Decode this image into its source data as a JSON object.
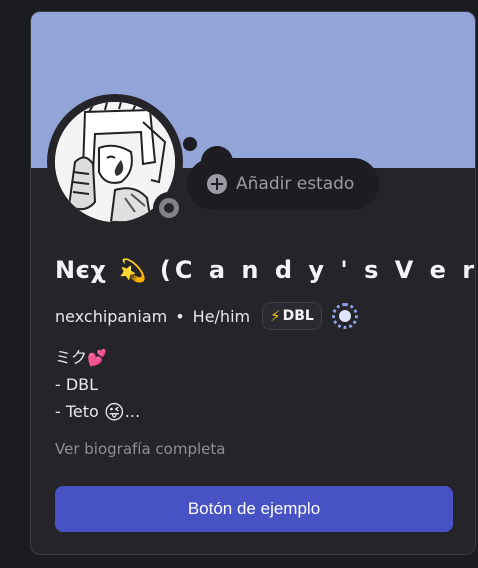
{
  "profile": {
    "display_name_prefix": "Nєχ",
    "display_name_icon": "💫",
    "display_name_suffix": "(C a n d y ' s V e r s)",
    "username": "nexchipaniam",
    "separator": "•",
    "pronouns": "He/him",
    "tag_icon": "⚡",
    "tag_label": "DBL",
    "status_button_label": "Añadir estado",
    "bio_lines": {
      "line1_text": "ミク",
      "line1_emoji": "💕",
      "line2": "- DBL",
      "line3_text": "- Teto",
      "line3_emoji": "😜",
      "line3_tail": "..."
    },
    "bio_link": "Ver biografía completa",
    "button_label": "Botón de ejemplo"
  },
  "colors": {
    "banner": "#93a4d8",
    "card": "#242429",
    "button": "#4752c4"
  },
  "icons": [
    "plus-icon",
    "sparkle-icon",
    "bolt-icon",
    "badge-icon",
    "status-icon",
    "heart-icon",
    "wink-emoji-icon"
  ]
}
